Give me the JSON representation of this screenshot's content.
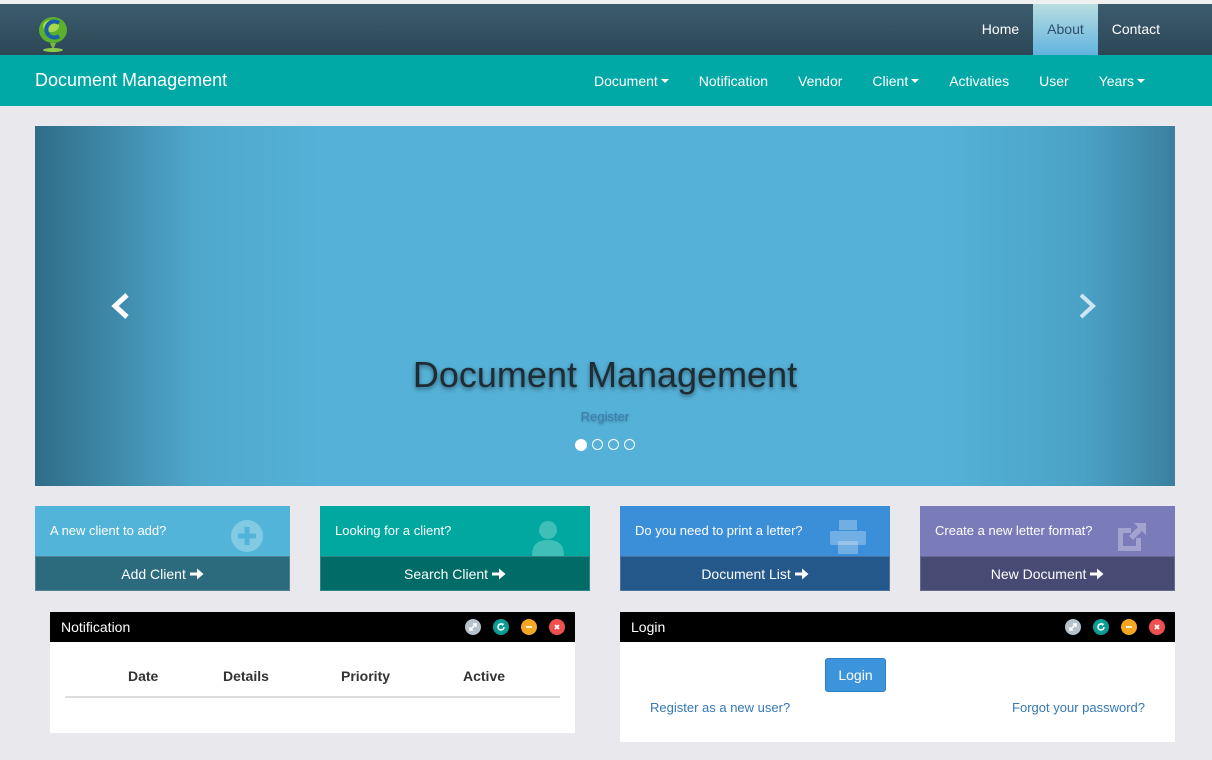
{
  "topnav": {
    "items": [
      "Home",
      "About",
      "Contact"
    ]
  },
  "navbar": {
    "brand": "Document Management",
    "items": [
      "Document",
      "Notification",
      "Vendor",
      "Client",
      "Activaties",
      "User",
      "Years"
    ]
  },
  "carousel": {
    "title": "Document Management",
    "link": "Register",
    "slide_count": 4,
    "active_slide": 1
  },
  "tiles": [
    {
      "prompt": "A new client to add?",
      "action": "Add Client",
      "icon": "plus-circle-icon",
      "color": "#52b4d8",
      "bottom_color": "#2c6a7e"
    },
    {
      "prompt": "Looking for a client?",
      "action": "Search Client",
      "icon": "user-icon",
      "color": "#00a8a0",
      "bottom_color": "#016b67"
    },
    {
      "prompt": "Do you need to print a letter?",
      "action": "Document List",
      "icon": "print-icon",
      "color": "#3b8fd9",
      "bottom_color": "#24578a"
    },
    {
      "prompt": "Create a new letter format?",
      "action": "New Document",
      "icon": "external-link-icon",
      "color": "#7a7cb9",
      "bottom_color": "#474a73"
    }
  ],
  "notification_panel": {
    "title": "Notification",
    "columns": [
      "Date",
      "Details",
      "Priority",
      "Active"
    ]
  },
  "login_panel": {
    "title": "Login",
    "button": "Login",
    "register_link": "Register as a new user?",
    "forgot_link": "Forgot your password?"
  }
}
